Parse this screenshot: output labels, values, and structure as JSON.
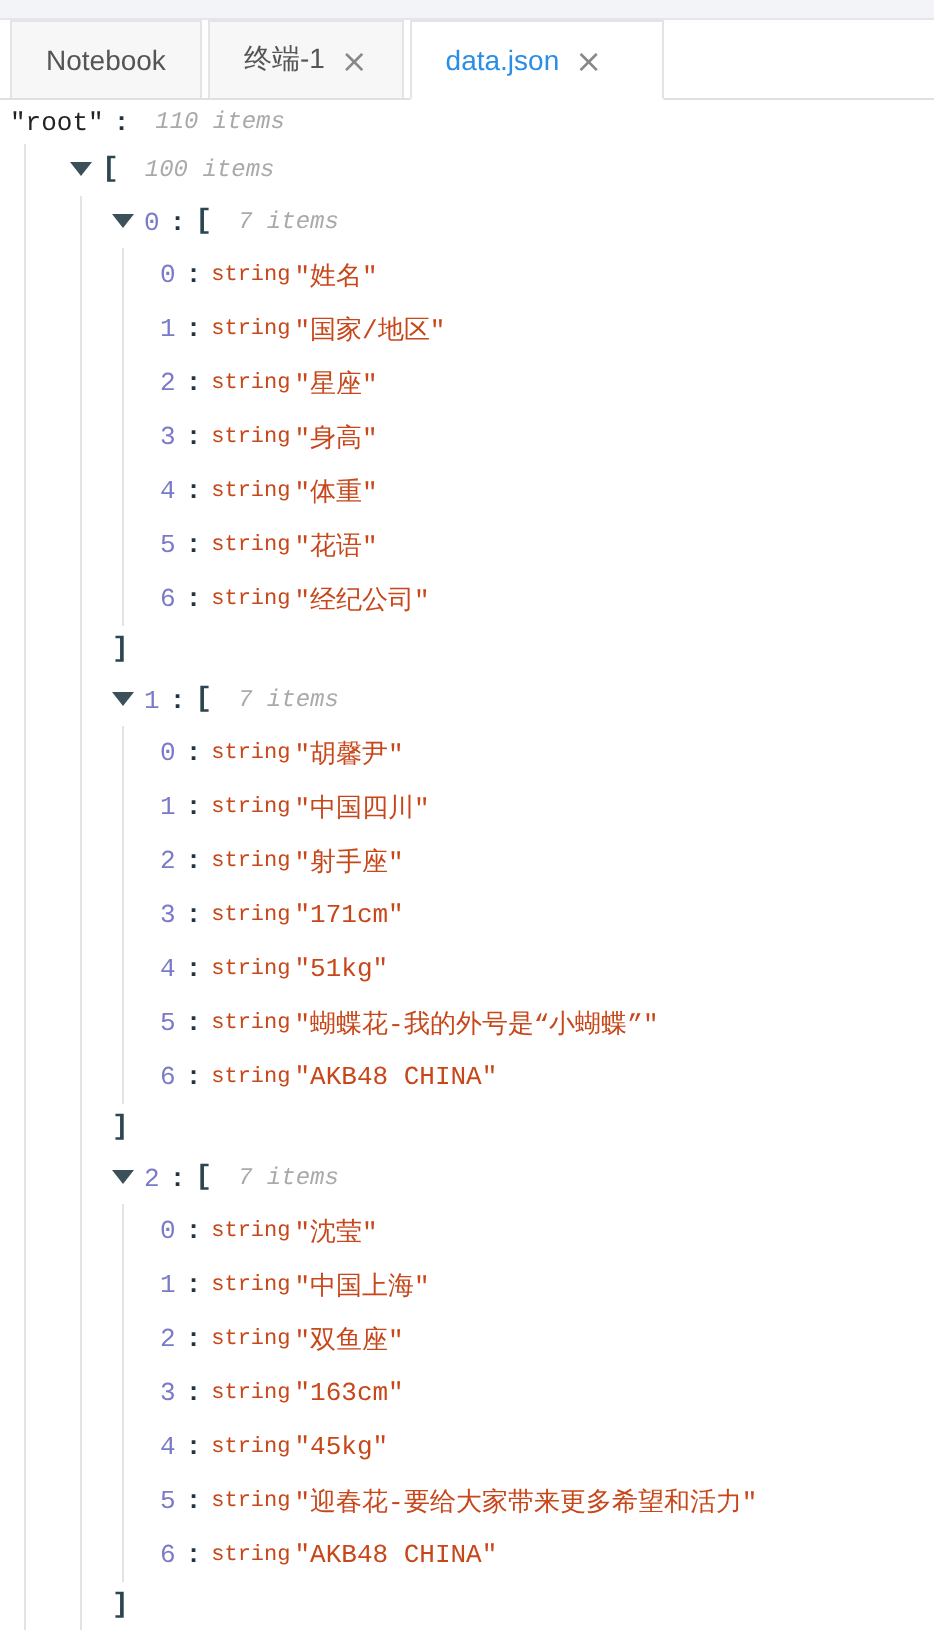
{
  "tabs": [
    {
      "label": "Notebook",
      "selected": false
    },
    {
      "label": "终端-1",
      "selected": false,
      "close": "×"
    },
    {
      "label": "data.json",
      "selected": true,
      "close": "×"
    }
  ],
  "tree": {
    "key": "\"root\"",
    "sep": ":",
    "count": "110 items",
    "kind": "object",
    "children": [
      {
        "kind": "array",
        "open": "[",
        "count": "100 items",
        "expanded": true,
        "children": [
          {
            "kind": "array",
            "key": "0",
            "sep": ":",
            "open": "[",
            "count": "7 items",
            "expanded": true,
            "close": "]",
            "children": [
              {
                "kind": "string",
                "key": "0",
                "sep": ":",
                "type": "string",
                "value": "\"姓名\""
              },
              {
                "kind": "string",
                "key": "1",
                "sep": ":",
                "type": "string",
                "value": "\"国家/地区\""
              },
              {
                "kind": "string",
                "key": "2",
                "sep": ":",
                "type": "string",
                "value": "\"星座\""
              },
              {
                "kind": "string",
                "key": "3",
                "sep": ":",
                "type": "string",
                "value": "\"身高\""
              },
              {
                "kind": "string",
                "key": "4",
                "sep": ":",
                "type": "string",
                "value": "\"体重\""
              },
              {
                "kind": "string",
                "key": "5",
                "sep": ":",
                "type": "string",
                "value": "\"花语\""
              },
              {
                "kind": "string",
                "key": "6",
                "sep": ":",
                "type": "string",
                "value": "\"经纪公司\""
              }
            ]
          },
          {
            "kind": "array",
            "key": "1",
            "sep": ":",
            "open": "[",
            "count": "7 items",
            "expanded": true,
            "close": "]",
            "children": [
              {
                "kind": "string",
                "key": "0",
                "sep": ":",
                "type": "string",
                "value": "\"胡馨尹\""
              },
              {
                "kind": "string",
                "key": "1",
                "sep": ":",
                "type": "string",
                "value": "\"中国四川\""
              },
              {
                "kind": "string",
                "key": "2",
                "sep": ":",
                "type": "string",
                "value": "\"射手座\""
              },
              {
                "kind": "string",
                "key": "3",
                "sep": ":",
                "type": "string",
                "value": "\"171cm\""
              },
              {
                "kind": "string",
                "key": "4",
                "sep": ":",
                "type": "string",
                "value": "\"51kg\""
              },
              {
                "kind": "string",
                "key": "5",
                "sep": ":",
                "type": "string",
                "value": "\"蝴蝶花-我的外号是“小蝴蝶”\""
              },
              {
                "kind": "string",
                "key": "6",
                "sep": ":",
                "type": "string",
                "value": "\"AKB48 CHINA\""
              }
            ]
          },
          {
            "kind": "array",
            "key": "2",
            "sep": ":",
            "open": "[",
            "count": "7 items",
            "expanded": true,
            "close": "]",
            "children": [
              {
                "kind": "string",
                "key": "0",
                "sep": ":",
                "type": "string",
                "value": "\"沈莹\""
              },
              {
                "kind": "string",
                "key": "1",
                "sep": ":",
                "type": "string",
                "value": "\"中国上海\""
              },
              {
                "kind": "string",
                "key": "2",
                "sep": ":",
                "type": "string",
                "value": "\"双鱼座\""
              },
              {
                "kind": "string",
                "key": "3",
                "sep": ":",
                "type": "string",
                "value": "\"163cm\""
              },
              {
                "kind": "string",
                "key": "4",
                "sep": ":",
                "type": "string",
                "value": "\"45kg\""
              },
              {
                "kind": "string",
                "key": "5",
                "sep": ":",
                "type": "string",
                "value": "\"迎春花-要给大家带来更多希望和活力\""
              },
              {
                "kind": "string",
                "key": "6",
                "sep": ":",
                "type": "string",
                "value": "\"AKB48 CHINA\""
              }
            ]
          }
        ]
      }
    ]
  }
}
